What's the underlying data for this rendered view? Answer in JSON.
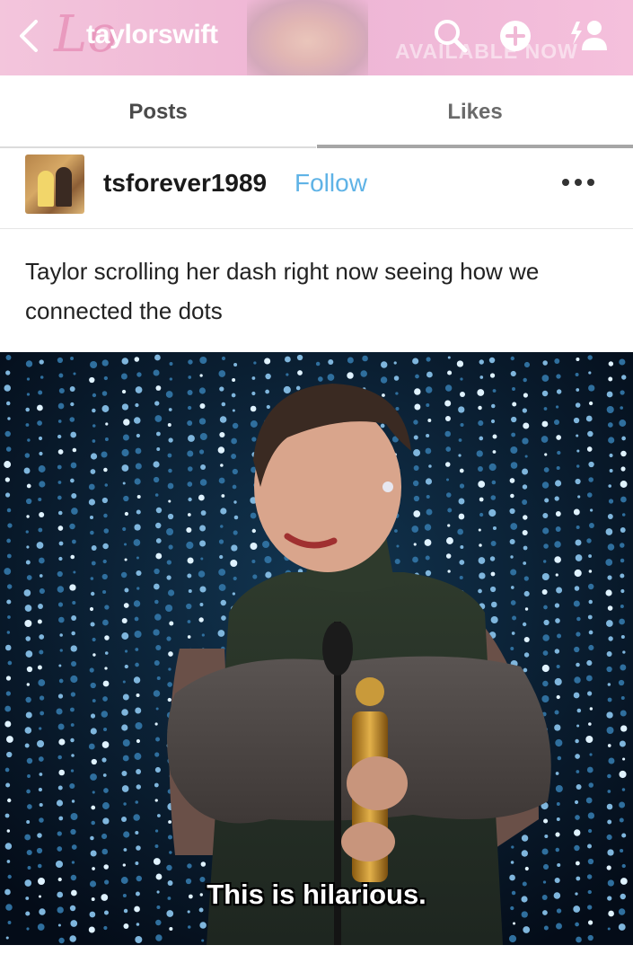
{
  "header": {
    "title": "taylorswift",
    "background_script_text": "Lo",
    "background_banner_text": "AVAILABLE NOW",
    "icons": [
      "back-chevron-icon",
      "search-icon",
      "plus-circle-icon",
      "add-user-icon"
    ]
  },
  "tabs": [
    {
      "label": "Posts"
    },
    {
      "label": "Likes"
    }
  ],
  "post": {
    "username": "tsforever1989",
    "follow_label": "Follow",
    "caption": "Taylor scrolling her dash right now seeing how we connected the dots",
    "subtitle": "This is hilarious."
  },
  "colors": {
    "header_pink": "#f0b9d6",
    "follow_blue": "#5fb3e6",
    "text_dark": "#1a1a1a"
  }
}
